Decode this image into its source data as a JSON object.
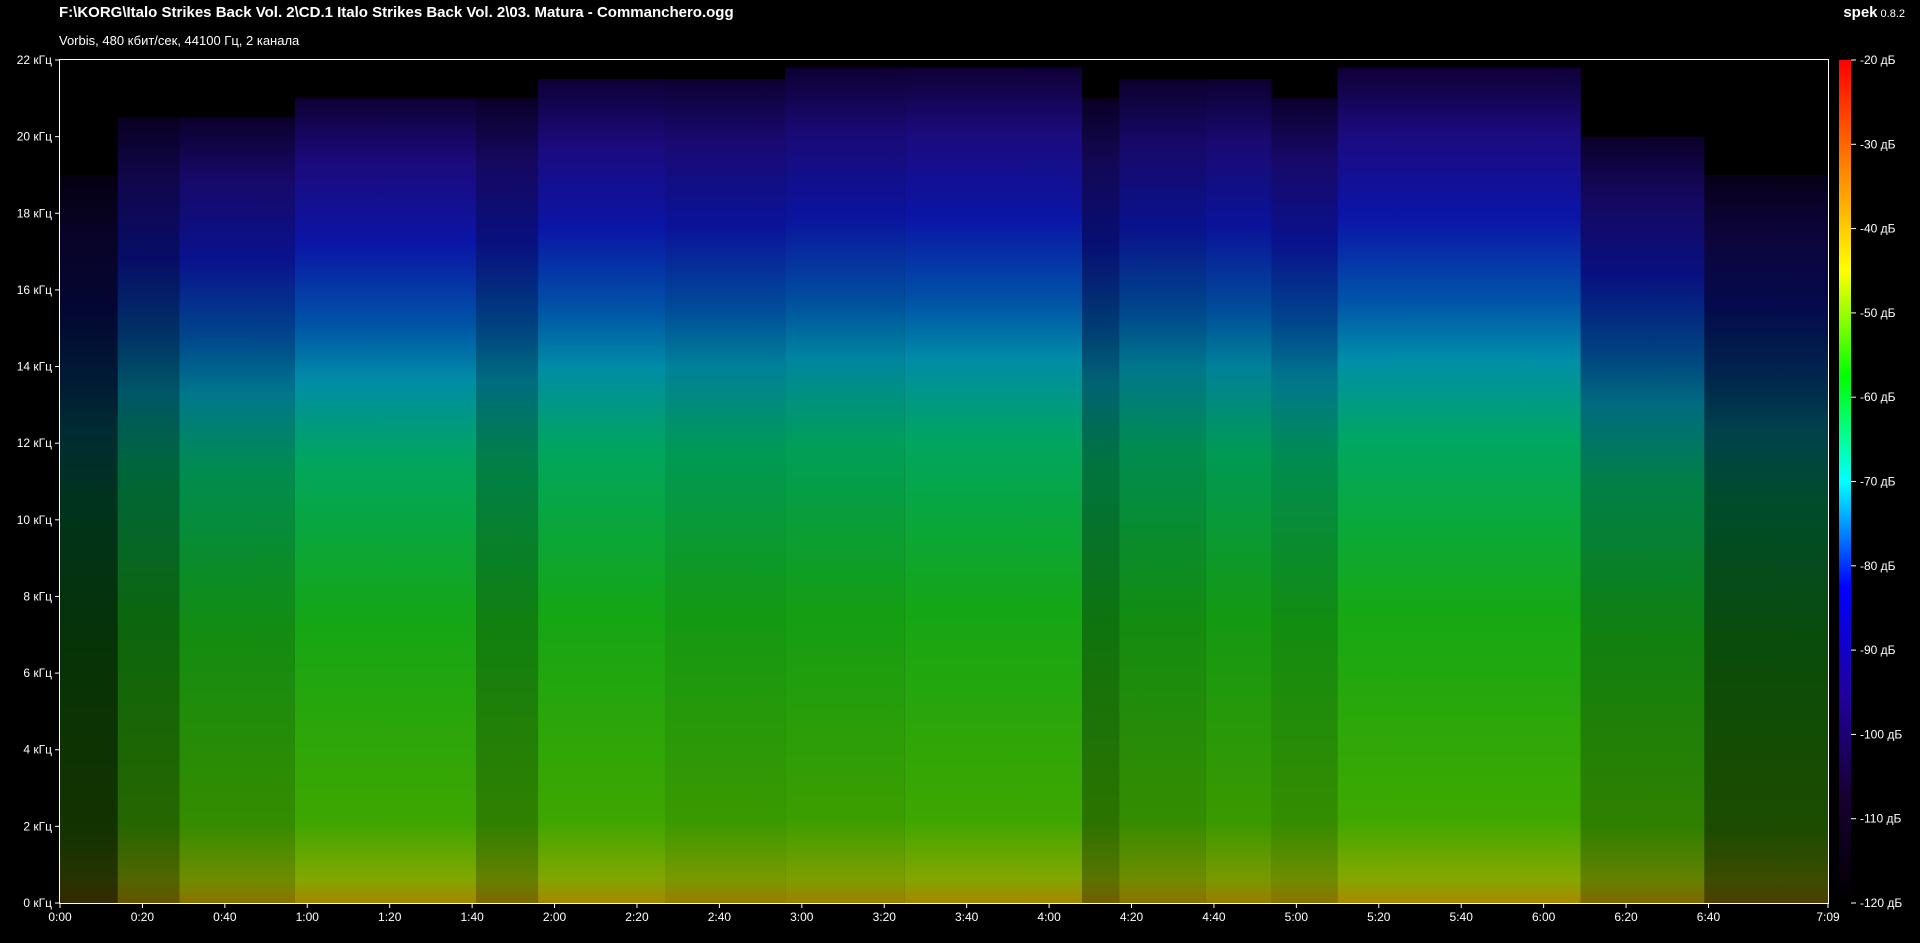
{
  "window": {
    "title": "F:\\KORG\\Italo Strikes Back Vol. 2\\CD.1 Italo Strikes Back Vol. 2\\03. Matura - Commanchero.ogg",
    "subtitle": "Vorbis, 480 кбит/сек, 44100 Гц, 2 канала",
    "app_name": "spek",
    "app_version": "0.8.2"
  },
  "colors": {
    "background": "#000000",
    "text": "#ffffff",
    "frame": "#ffffff"
  },
  "chart_data": {
    "type": "heatmap",
    "frequency_axis": {
      "unit": "кГц",
      "range": [
        0,
        22
      ],
      "ticks": [
        "0 кГц",
        "2 кГц",
        "4 кГц",
        "6 кГц",
        "8 кГц",
        "10 кГц",
        "12 кГц",
        "14 кГц",
        "16 кГц",
        "18 кГц",
        "20 кГц",
        "22 кГц"
      ]
    },
    "time_axis": {
      "range_seconds": [
        0,
        429
      ],
      "ticks": [
        "0:00",
        "0:20",
        "0:40",
        "1:00",
        "1:20",
        "1:40",
        "2:00",
        "2:20",
        "2:40",
        "3:00",
        "3:20",
        "3:40",
        "4:00",
        "4:20",
        "4:40",
        "5:00",
        "5:20",
        "5:40",
        "6:00",
        "6:20",
        "6:40",
        "7:09"
      ]
    },
    "level_scale": {
      "unit": "дБ",
      "range": [
        -120,
        -20
      ],
      "ticks": [
        "-20 дБ",
        "-30 дБ",
        "-40 дБ",
        "-50 дБ",
        "-60 дБ",
        "-70 дБ",
        "-80 дБ",
        "-90 дБ",
        "-100 дБ",
        "-110 дБ",
        "-120 дБ"
      ],
      "gradient": [
        "#ff0000",
        "#ff8000",
        "#ffff00",
        "#00ff00",
        "#00ffff",
        "#0000ff",
        "#2000a0",
        "#180030",
        "#000000"
      ]
    },
    "segments": [
      {
        "start": 0,
        "end": 14,
        "top_khz": 19,
        "level": 0.2
      },
      {
        "start": 14,
        "end": 29,
        "top_khz": 20.5,
        "level": 0.4
      },
      {
        "start": 29,
        "end": 57,
        "top_khz": 20.5,
        "level": 0.55
      },
      {
        "start": 57,
        "end": 101,
        "top_khz": 21,
        "level": 0.65
      },
      {
        "start": 101,
        "end": 116,
        "top_khz": 21,
        "level": 0.5
      },
      {
        "start": 116,
        "end": 147,
        "top_khz": 21.5,
        "level": 0.65
      },
      {
        "start": 147,
        "end": 176,
        "top_khz": 21.5,
        "level": 0.6
      },
      {
        "start": 176,
        "end": 205,
        "top_khz": 21.8,
        "level": 0.62
      },
      {
        "start": 205,
        "end": 248,
        "top_khz": 21.8,
        "level": 0.65
      },
      {
        "start": 248,
        "end": 257,
        "top_khz": 21,
        "level": 0.45
      },
      {
        "start": 257,
        "end": 278,
        "top_khz": 21.5,
        "level": 0.55
      },
      {
        "start": 278,
        "end": 294,
        "top_khz": 21.5,
        "level": 0.6
      },
      {
        "start": 294,
        "end": 310,
        "top_khz": 21,
        "level": 0.55
      },
      {
        "start": 310,
        "end": 369,
        "top_khz": 21.8,
        "level": 0.66
      },
      {
        "start": 369,
        "end": 399,
        "top_khz": 20,
        "level": 0.5
      },
      {
        "start": 399,
        "end": 429,
        "top_khz": 19,
        "level": 0.3
      }
    ]
  }
}
